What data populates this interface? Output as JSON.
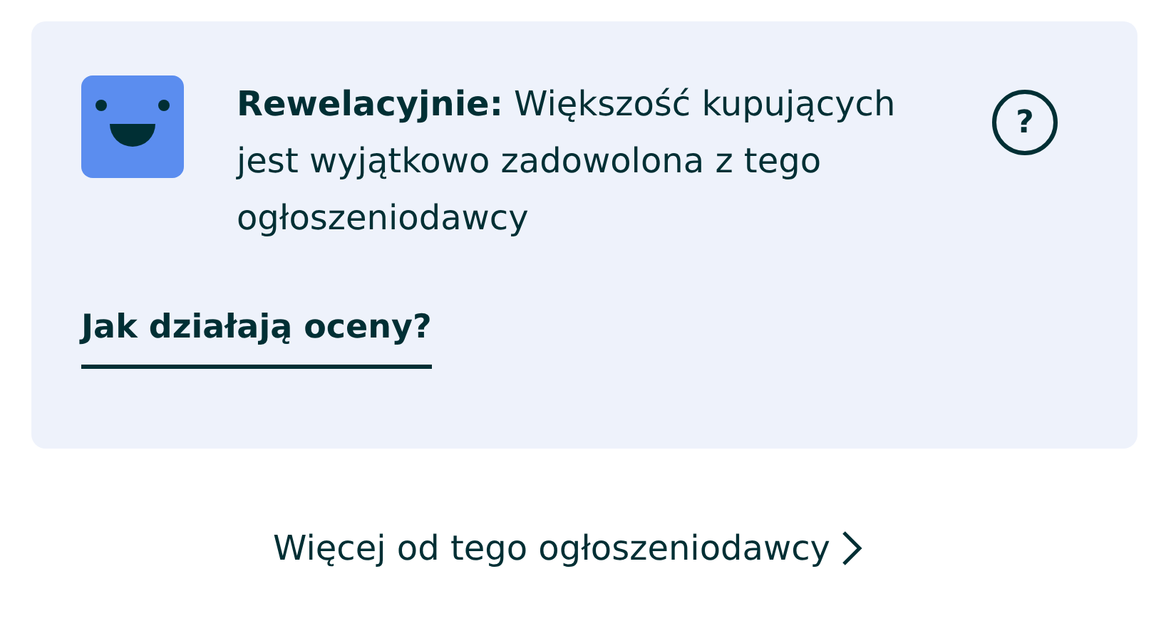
{
  "rating_card": {
    "message": "**Rewelacyjnie:** Większość kupujących jest wyjątkowo zadowolona z tego ogłoszeniodawcy",
    "help_icon": "?",
    "link": "Jak działają oceny?"
  },
  "more_link": "Więcej od tego ogłoszeniodawcy"
}
